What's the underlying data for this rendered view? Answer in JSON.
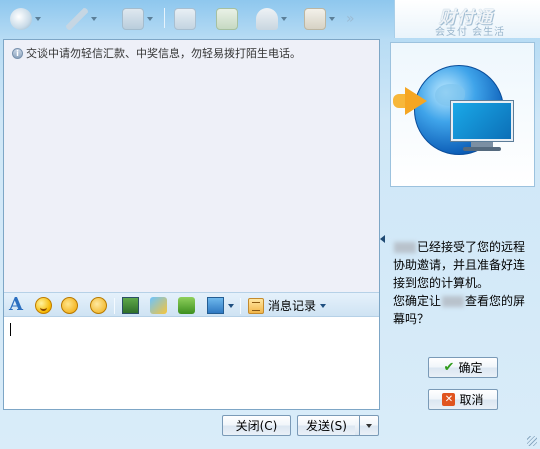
{
  "toolbar": {
    "items": [
      {
        "icon": "video-call-icon"
      },
      {
        "icon": "voice-call-icon"
      },
      {
        "icon": "send-file-icon"
      },
      {
        "icon": "remote-assist-icon"
      },
      {
        "icon": "group-chat-icon"
      },
      {
        "icon": "contact-info-icon"
      },
      {
        "icon": "apps-icon"
      }
    ],
    "overflow": "»"
  },
  "brand": {
    "main_text": "财付通",
    "sub_text": "会支付 会生活"
  },
  "chat": {
    "notice": "交谈中请勿轻信汇款、中奖信息，勿轻易拨打陌生电话。"
  },
  "format_bar": {
    "font_label": "A",
    "message_history_label": "消息记录"
  },
  "buttons": {
    "close": "关闭(C)",
    "send": "发送(S)",
    "confirm": "确定",
    "cancel": "取消"
  },
  "remote_prompt": {
    "line1": "已经接受了您的远程协助邀请，并且准备好连接到您的计算机。",
    "line2_a": "您确定让",
    "line2_b": "查看您的屏幕吗？"
  },
  "colors": {
    "accent": "#2c6fc0",
    "confirm_green": "#2f9b1b",
    "cancel_orange": "#e0541f"
  }
}
